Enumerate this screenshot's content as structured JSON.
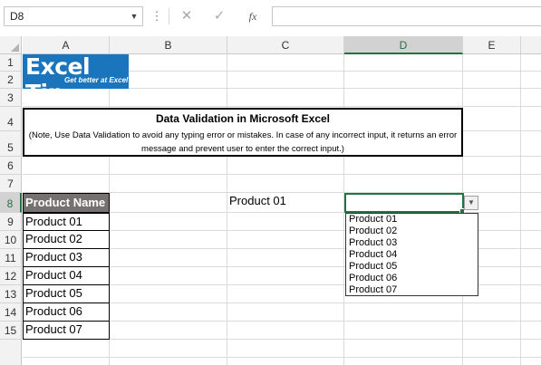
{
  "formula_bar": {
    "name_box": "D8",
    "fx_label": "fx",
    "cancel_glyph": "✕",
    "enter_glyph": "✓",
    "formula": ""
  },
  "columns": [
    "A",
    "B",
    "C",
    "D",
    "E"
  ],
  "selected_column": "D",
  "rows": [
    "1",
    "2",
    "3",
    "4",
    "5",
    "6",
    "7",
    "8",
    "9",
    "10",
    "11",
    "12",
    "13",
    "14",
    "15"
  ],
  "selected_row": "8",
  "logo": {
    "main": "Excel Tip",
    "tagline": "Get better at Excel"
  },
  "title_box": {
    "title": "Data Validation in Microsoft Excel",
    "note": "(Note, Use Data Validation to avoid any typing error or mistakes. In case of any incorrect input, it returns an error message and prevent user to enter the correct input.)"
  },
  "product_table": {
    "header": "Product Name",
    "items": [
      "Product 01",
      "Product 02",
      "Product 03",
      "Product 04",
      "Product 05",
      "Product 06",
      "Product 07"
    ]
  },
  "cell_c8": "Product 01",
  "active_cell_value": "",
  "dropdown": {
    "options": [
      "Product 01",
      "Product 02",
      "Product 03",
      "Product 04",
      "Product 05",
      "Product 06",
      "Product 07"
    ]
  },
  "colors": {
    "selection_green": "#217346",
    "header_fill": "#767171",
    "logo_blue": "#1b75bc"
  },
  "icons": [
    "name-box-dropdown-icon",
    "more-options-icon",
    "cancel-icon",
    "enter-icon",
    "insert-function-icon",
    "dropdown-arrow-icon"
  ]
}
